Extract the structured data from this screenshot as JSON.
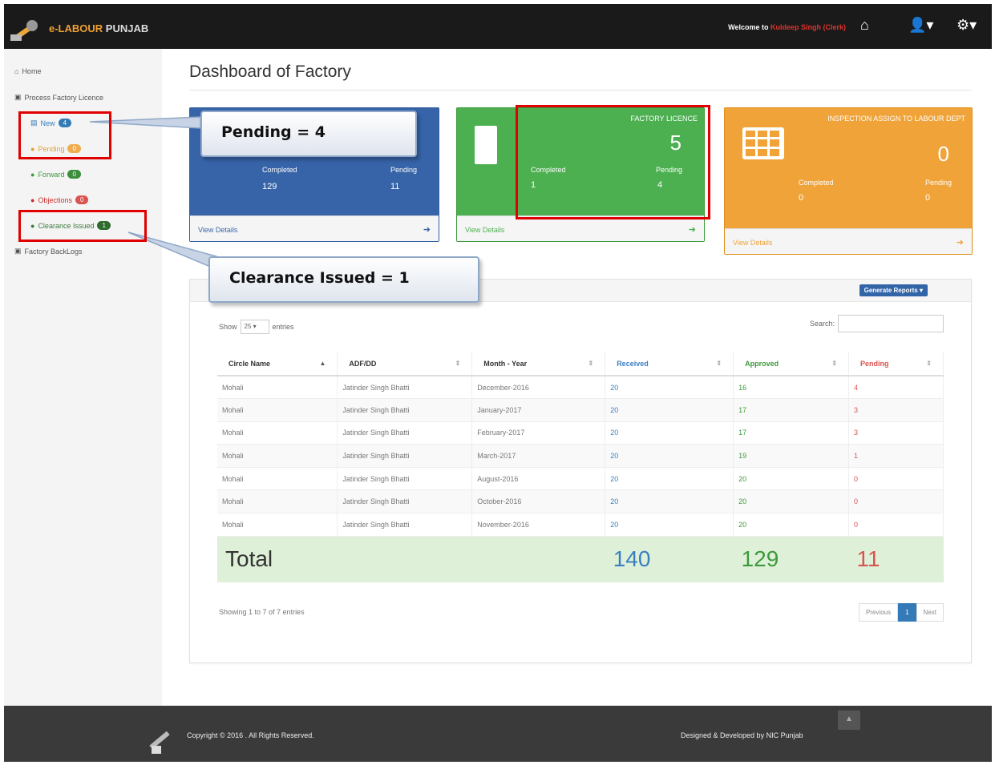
{
  "navbar": {
    "brand_prefix": "e-LABOUR",
    "brand_suffix": " PUNJAB",
    "welcome_prefix": "Welcome to ",
    "welcome_user": "Kuldeep Singh (Clerk)"
  },
  "sidebar": {
    "home": "Home",
    "process": "Process Factory Licence",
    "new": {
      "label": "New",
      "count": "4"
    },
    "pending": {
      "label": "Pending",
      "count": "0"
    },
    "forward": {
      "label": "Forward",
      "count": "0"
    },
    "objections": {
      "label": "Objections",
      "count": "0"
    },
    "clearance": {
      "label": "Clearance Issued",
      "count": "1"
    },
    "backlogs": "Factory BackLogs"
  },
  "page_title": "Dashboard of Factory",
  "panels": {
    "blue": {
      "completed_label": "Completed",
      "completed": "129",
      "pending_label": "Pending",
      "pending": "11",
      "view": "View Details"
    },
    "green": {
      "title": "FACTORY LICENCE",
      "big": "5",
      "completed_label": "Completed",
      "completed": "1",
      "pending_label": "Pending",
      "pending": "4",
      "view": "View Details"
    },
    "orange": {
      "title": "INSPECTION ASSIGN TO LABOUR DEPT",
      "big": "0",
      "completed_label": "Completed",
      "completed": "0",
      "pending_label": "Pending",
      "pending": "0",
      "view": "View Details"
    }
  },
  "report": {
    "generate_btn": "Generate Reports",
    "show_label": "Show",
    "show_value": "25",
    "entries_label": "entries",
    "search_label": "Search:",
    "columns": [
      "Circle Name",
      "ADF/DD",
      "Month - Year",
      "Received",
      "Approved",
      "Pending"
    ],
    "rows": [
      [
        "Mohali",
        "Jatinder Singh Bhatti",
        "December-2016",
        "20",
        "16",
        "4"
      ],
      [
        "Mohali",
        "Jatinder Singh Bhatti",
        "January-2017",
        "20",
        "17",
        "3"
      ],
      [
        "Mohali",
        "Jatinder Singh Bhatti",
        "February-2017",
        "20",
        "17",
        "3"
      ],
      [
        "Mohali",
        "Jatinder Singh Bhatti",
        "March-2017",
        "20",
        "19",
        "1"
      ],
      [
        "Mohali",
        "Jatinder Singh Bhatti",
        "August-2016",
        "20",
        "20",
        "0"
      ],
      [
        "Mohali",
        "Jatinder Singh Bhatti",
        "October-2016",
        "20",
        "20",
        "0"
      ],
      [
        "Mohali",
        "Jatinder Singh Bhatti",
        "November-2016",
        "20",
        "20",
        "0"
      ]
    ],
    "total_label": "Total",
    "total_received": "140",
    "total_approved": "129",
    "total_pending": "11",
    "info": "Showing 1 to 7 of 7 entries",
    "prev": "Previous",
    "page": "1",
    "next": "Next"
  },
  "annotations": {
    "pending_callout": "Pending = 4",
    "clearance_callout": "Clearance Issued = 1"
  },
  "footer": {
    "copyright": "Copyright © 2016 . All Rights Reserved.",
    "designed": "Designed & Developed by NIC Punjab"
  }
}
